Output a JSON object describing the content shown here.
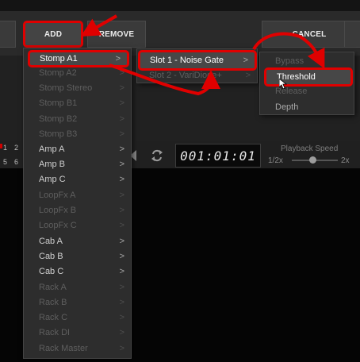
{
  "toolbar": {
    "add_label": "ADD",
    "remove_label": "REMOVE",
    "cancel_label": "CANCEL"
  },
  "transport": {
    "counter_text": "001:01:01",
    "playback_speed_label": "Playback Speed",
    "speed_min": "1/2x",
    "speed_max": "2x",
    "track_numbers": [
      "1",
      "2",
      "5",
      "6"
    ]
  },
  "menu_level1": [
    {
      "label": "Stomp A1",
      "enabled": true,
      "submenu": true
    },
    {
      "label": "Stomp A2",
      "enabled": false,
      "submenu": true
    },
    {
      "label": "Stomp Stereo",
      "enabled": false,
      "submenu": true
    },
    {
      "label": "Stomp B1",
      "enabled": false,
      "submenu": true
    },
    {
      "label": "Stomp B2",
      "enabled": false,
      "submenu": true
    },
    {
      "label": "Stomp B3",
      "enabled": false,
      "submenu": true
    },
    {
      "label": "Amp A",
      "enabled": true,
      "submenu": true
    },
    {
      "label": "Amp B",
      "enabled": true,
      "submenu": true
    },
    {
      "label": "Amp C",
      "enabled": true,
      "submenu": true
    },
    {
      "label": "LoopFx A",
      "enabled": false,
      "submenu": true
    },
    {
      "label": "LoopFx B",
      "enabled": false,
      "submenu": true
    },
    {
      "label": "LoopFx C",
      "enabled": false,
      "submenu": true
    },
    {
      "label": "Cab A",
      "enabled": true,
      "submenu": true
    },
    {
      "label": "Cab B",
      "enabled": true,
      "submenu": true
    },
    {
      "label": "Cab C",
      "enabled": true,
      "submenu": true
    },
    {
      "label": "Rack A",
      "enabled": false,
      "submenu": true
    },
    {
      "label": "Rack B",
      "enabled": false,
      "submenu": true
    },
    {
      "label": "Rack C",
      "enabled": false,
      "submenu": true
    },
    {
      "label": "Rack DI",
      "enabled": false,
      "submenu": true
    },
    {
      "label": "Rack Master",
      "enabled": false,
      "submenu": true
    }
  ],
  "menu_level2": [
    {
      "label": "Slot 1 - Noise Gate",
      "enabled": true,
      "submenu": true
    },
    {
      "label": "Slot 2 - VariDiode+",
      "enabled": false,
      "submenu": true
    }
  ],
  "menu_level3": [
    {
      "label": "Bypass",
      "enabled": false
    },
    {
      "label": "Threshold",
      "enabled": true
    },
    {
      "label": "Release",
      "enabled": false
    },
    {
      "label": "Depth",
      "enabled": false
    }
  ],
  "colors": {
    "highlight_border": "#e00000",
    "menu_bg": "#2d2d2d",
    "disabled_text": "#5e5e5e",
    "annotation_arrows": "#e00000"
  },
  "icons": [
    "chevron-right-icon",
    "loop-icon",
    "play-back-icon",
    "mouse-cursor-icon"
  ]
}
